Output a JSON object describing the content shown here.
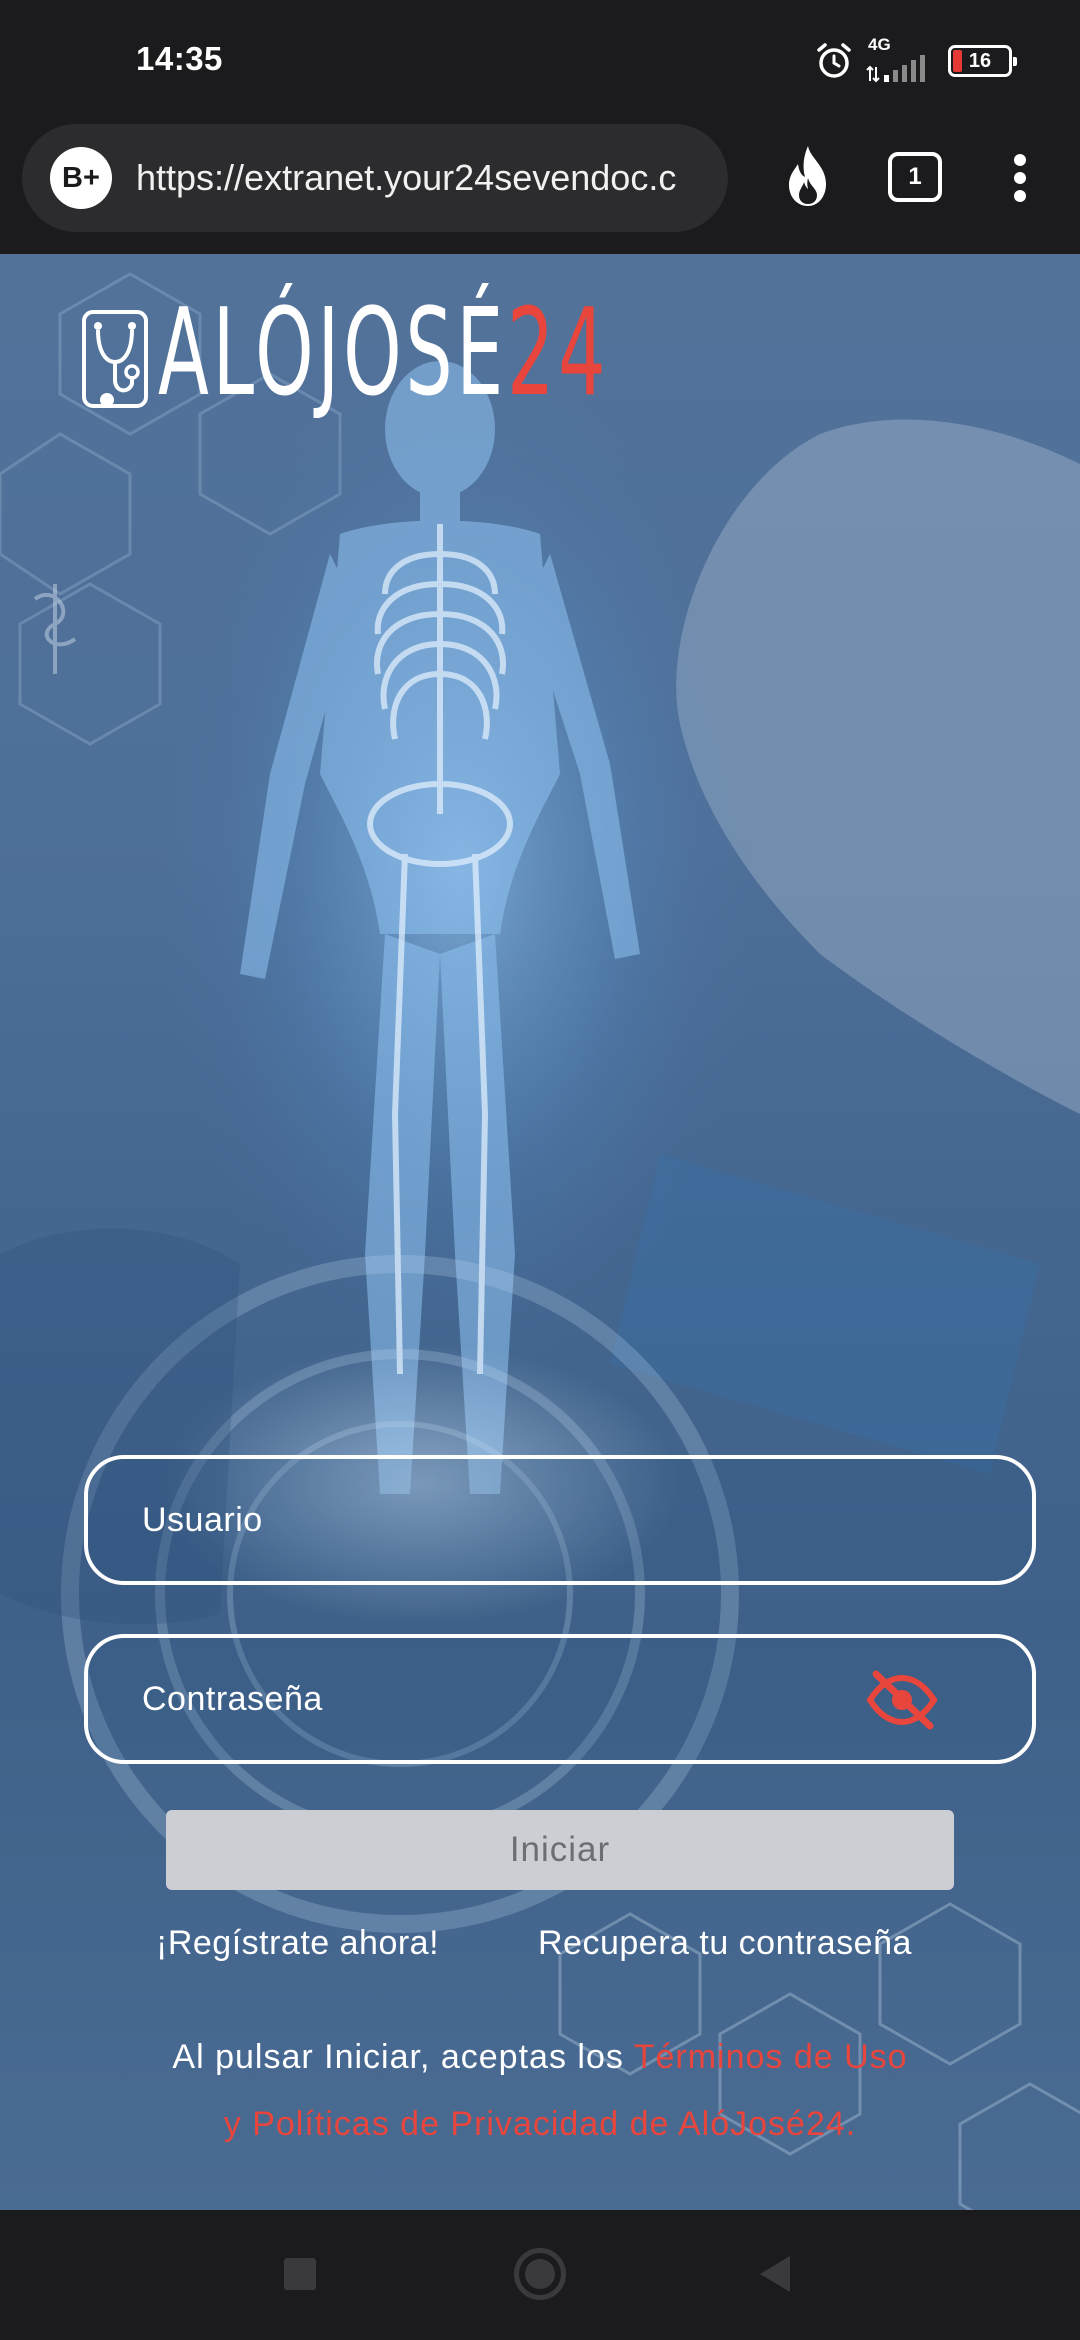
{
  "status_bar": {
    "time": "14:35",
    "network_label": "4G",
    "battery_level": "16",
    "icons": [
      "alarm-icon",
      "signal-icon",
      "battery-icon"
    ]
  },
  "browser": {
    "site_badge": "B+",
    "url": "https://extranet.your24sevendoc.c",
    "tab_count": "1",
    "icons": [
      "fire-icon",
      "tabs-icon",
      "more-vert-icon"
    ]
  },
  "logo": {
    "text_main": "ALÓJOSÉ",
    "text_accent": "24",
    "icon": "stethoscope-icon"
  },
  "login": {
    "username_placeholder": "Usuario",
    "password_placeholder": "Contraseña",
    "submit_label": "Iniciar",
    "register_link": "¡Regístrate ahora!",
    "recover_link": "Recupera tu contraseña",
    "terms_prefix": "Al pulsar Iniciar, aceptas los ",
    "terms_link_part1": "Términos de Uso",
    "terms_link_part2": "y Políticas de Privacidad de AlóJosé24."
  },
  "colors": {
    "accent": "#e8453c",
    "button_bg": "#cdced3",
    "button_text": "#6d6e73",
    "chrome_bg": "#1b1b1d"
  }
}
